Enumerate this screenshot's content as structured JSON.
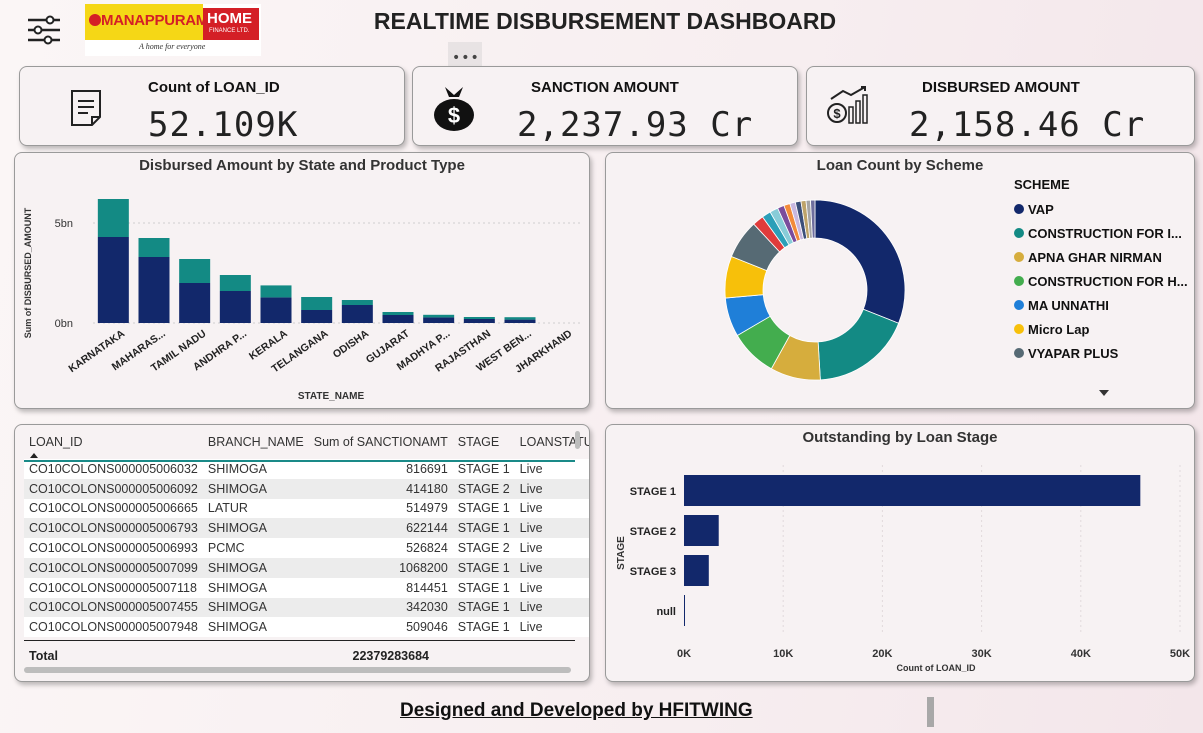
{
  "header": {
    "title": "REALTIME DISBURSEMENT DASHBOARD",
    "logo_brand": "MANAPPURAM",
    "logo_home": "HOME",
    "logo_sub": "FINANCE LTD.",
    "logo_tagline": "A home for everyone",
    "more_label": "•••"
  },
  "kpis": [
    {
      "label": "Count of LOAN_ID",
      "value": "52.109K",
      "icon": "document-icon"
    },
    {
      "label": "SANCTION AMOUNT",
      "value": "2,237.93 Cr",
      "icon": "money-bag-icon"
    },
    {
      "label": "DISBURSED AMOUNT",
      "value": "2,158.46 Cr",
      "icon": "dollar-growth-icon"
    }
  ],
  "chart_data": [
    {
      "type": "bar",
      "title": "Disbursed Amount by State and Product Type",
      "xlabel": "STATE_NAME",
      "ylabel": "Sum of DISBURSED_AMOUNT",
      "ytick_labels": [
        "0bn",
        "5bn"
      ],
      "ylim": [
        0,
        7000000000
      ],
      "categories": [
        "KARNATAKA",
        "MAHARAS...",
        "TAMIL NADU",
        "ANDHRA P...",
        "KERALA",
        "TELANGANA",
        "ODISHA",
        "GUJARAT",
        "MADHYA P...",
        "RAJASTHAN",
        "WEST BEN...",
        "JHARKHAND"
      ],
      "series": [
        {
          "color": "#12286b",
          "values": [
            4300000000,
            3300000000,
            2000000000,
            1600000000,
            1280000000,
            650000000,
            900000000,
            400000000,
            280000000,
            200000000,
            170000000,
            0
          ]
        },
        {
          "color": "#138a84",
          "values": [
            1900000000,
            950000000,
            1200000000,
            800000000,
            600000000,
            650000000,
            250000000,
            150000000,
            130000000,
            100000000,
            120000000,
            0
          ]
        }
      ],
      "stacked": true
    },
    {
      "type": "pie",
      "title": "Loan Count by Scheme",
      "legend_title": "SCHEME",
      "labels": [
        "VAP",
        "CONSTRUCTION FOR I...",
        "APNA GHAR NIRMAN",
        "CONSTRUCTION FOR H...",
        "MA UNNATHI",
        "Micro Lap",
        "VYAPAR PLUS",
        "",
        "",
        "",
        "",
        "",
        "",
        "",
        "",
        "",
        ""
      ],
      "values": [
        31,
        18,
        9,
        8.5,
        7,
        7.5,
        7,
        2,
        1.6,
        1.5,
        1.2,
        1.1,
        1.0,
        1.0,
        0.9,
        0.8,
        0.8
      ],
      "colors": [
        "#12286b",
        "#138a84",
        "#d6ad3d",
        "#43ad4e",
        "#1f7fd8",
        "#f7c00a",
        "#566a74",
        "#e03b3b",
        "#2c9fb8",
        "#88ccd8",
        "#7a4c9c",
        "#f28a3a",
        "#c8b8e0",
        "#3b4f7a",
        "#bda36a",
        "#a5a5a5",
        "#6e6e9e"
      ],
      "legend_position": "right"
    },
    {
      "type": "bar",
      "orientation": "horizontal",
      "title": "Outstanding by Loan Stage",
      "xlabel": "Count of LOAN_ID",
      "ylabel": "STAGE",
      "categories": [
        "STAGE 1",
        "STAGE 2",
        "STAGE 3",
        "null"
      ],
      "values": [
        46000,
        3500,
        2500,
        50
      ],
      "xlim": [
        0,
        50000
      ],
      "xtick_labels": [
        "0K",
        "10K",
        "20K",
        "30K",
        "40K",
        "50K"
      ],
      "color": "#12286b"
    }
  ],
  "table": {
    "columns": [
      "LOAN_ID",
      "BRANCH_NAME",
      "Sum of SANCTIONAMT",
      "STAGE",
      "LOANSTATUS"
    ],
    "rows": [
      [
        "CO10COLONS000005006032",
        "SHIMOGA",
        "816691",
        "STAGE 1",
        "Live"
      ],
      [
        "CO10COLONS000005006092",
        "SHIMOGA",
        "414180",
        "STAGE 2",
        "Live"
      ],
      [
        "CO10COLONS000005006665",
        "LATUR",
        "514979",
        "STAGE 1",
        "Live"
      ],
      [
        "CO10COLONS000005006793",
        "SHIMOGA",
        "622144",
        "STAGE 1",
        "Live"
      ],
      [
        "CO10COLONS000005006993",
        "PCMC",
        "526824",
        "STAGE 2",
        "Live"
      ],
      [
        "CO10COLONS000005007099",
        "SHIMOGA",
        "1068200",
        "STAGE 1",
        "Live"
      ],
      [
        "CO10COLONS000005007118",
        "SHIMOGA",
        "814451",
        "STAGE 1",
        "Live"
      ],
      [
        "CO10COLONS000005007455",
        "SHIMOGA",
        "342030",
        "STAGE 1",
        "Live"
      ],
      [
        "CO10COLONS000005007948",
        "SHIMOGA",
        "509046",
        "STAGE 1",
        "Live"
      ]
    ],
    "total_label": "Total",
    "total_value": "22379283684"
  },
  "footer": "Designed and Developed by HFITWING"
}
